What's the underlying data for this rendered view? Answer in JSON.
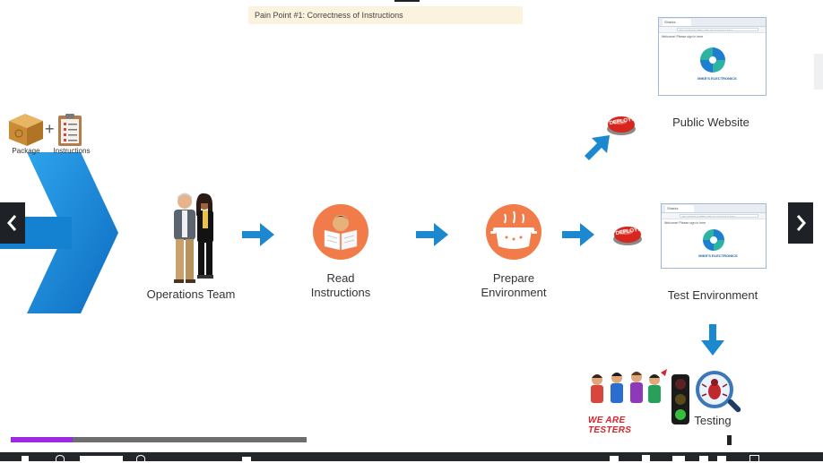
{
  "callout": {
    "text": "Pain Point #1: Correctness of Instructions"
  },
  "package_block": {
    "package_label": "Package",
    "plus": "+",
    "instructions_label": "Instructions"
  },
  "steps": {
    "operations_team": "Operations Team",
    "read_instructions_line1": "Read",
    "read_instructions_line2": "Instructions",
    "prepare_environment_line1": "Prepare",
    "prepare_environment_line2": "Environment"
  },
  "deploy_button": {
    "text": "DEPLOY!"
  },
  "public_website": {
    "label": "Public Website",
    "tab": "Sharks",
    "url": "http://127.0.0.1/Mikes/Electronics/index.html",
    "welcome": "Welcome! Please sign in here",
    "brand": "MIKE'S ELECTRONICS"
  },
  "test_environment": {
    "label": "Test Environment",
    "tab": "Sharks",
    "url": "http://127.0.0.1/Mikes/Electronics/index.html",
    "welcome": "Welcome! Please sign in here",
    "brand": "MIKE'S ELECTRONICS"
  },
  "testing": {
    "testers_text": "WE ARE TESTERS",
    "label": "Testing"
  },
  "player": {
    "prev_icon": "chevron-left-icon",
    "next_icon": "chevron-right-icon",
    "progress_fraction": 0.21,
    "buffered_fraction": 0.36,
    "colors": {
      "progress": "#9b2ae0",
      "track": "#6d6d6d",
      "controls": "#23262b",
      "accent_blue": "#1b88d0"
    }
  }
}
